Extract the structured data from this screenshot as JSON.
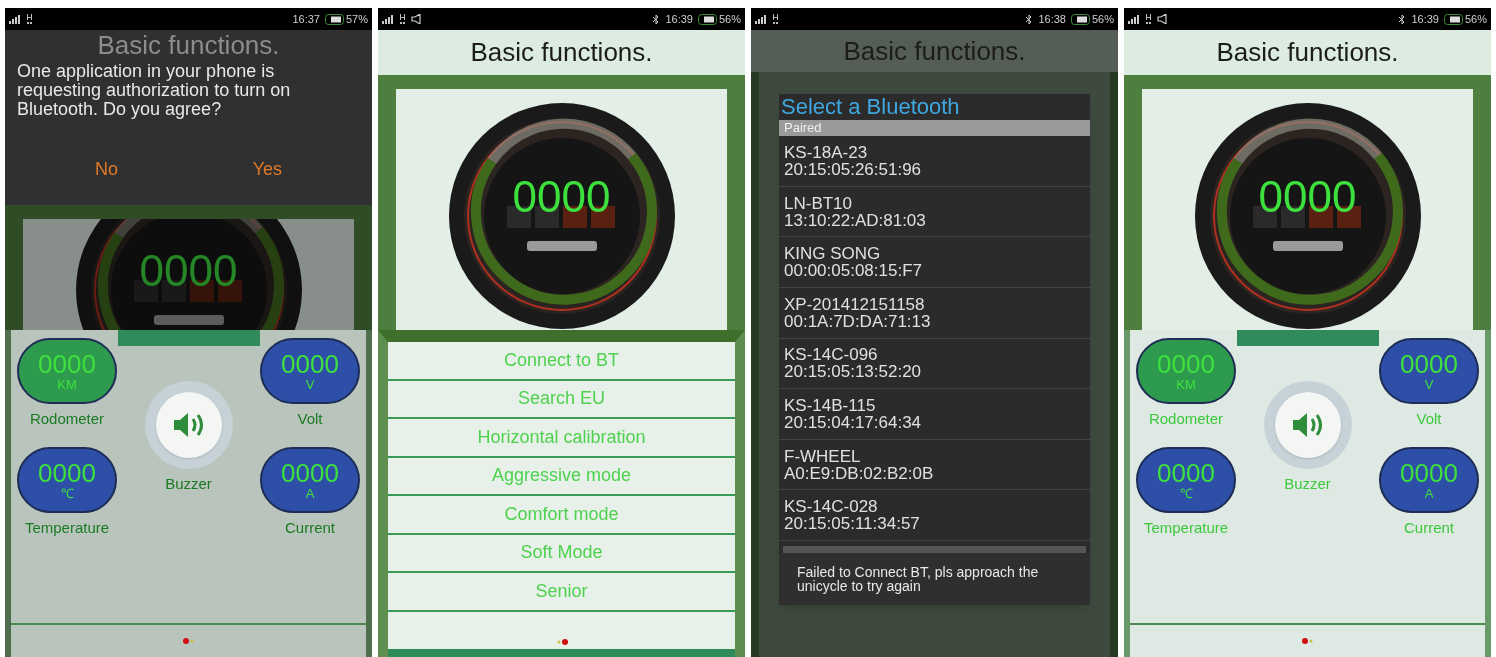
{
  "screens": [
    {
      "kind": "dashboard",
      "dimmed": true,
      "status_bar": {
        "time": "16:37",
        "battery": "57%",
        "bluetooth_icon": false,
        "volume_icon": false
      },
      "title": "Basic functions.",
      "dialog": {
        "message": "One application in your phone is requesting authorization to turn on Bluetooth. Do you agree?",
        "buttons": [
          "No",
          "Yes"
        ]
      },
      "gauge": {
        "reading": "0000"
      },
      "meters": [
        {
          "value": "0000",
          "unit": "KM",
          "label": "Rodometer",
          "color": "#2e9a4e"
        },
        {
          "value": "0000",
          "unit": "V",
          "label": "Volt",
          "color": "#2d4fa8"
        },
        {
          "value": "0000",
          "unit": "℃",
          "label": "Temperature",
          "color": "#2d4fa8"
        },
        {
          "value": "0000",
          "unit": "A",
          "label": "Current",
          "color": "#2d4fa8"
        }
      ],
      "buzzer": {
        "label": "Buzzer"
      }
    },
    {
      "kind": "menu",
      "dimmed": false,
      "status_bar": {
        "time": "16:39",
        "battery": "56%",
        "bluetooth_icon": true,
        "volume_icon": true
      },
      "title": "Basic functions.",
      "gauge": {
        "reading": "0000"
      },
      "menu_items": [
        "Connect to BT",
        "Search EU",
        "Horizontal calibration",
        "Aggressive mode",
        "Comfort mode",
        "Soft Mode",
        "Senior"
      ]
    },
    {
      "kind": "device_picker",
      "dimmed": true,
      "status_bar": {
        "time": "16:38",
        "battery": "56%",
        "bluetooth_icon": true,
        "volume_icon": false
      },
      "title": "Basic functions.",
      "picker": {
        "title": "Select a Bluetooth",
        "section": "Paired",
        "devices": [
          {
            "name": "KS-18A-23",
            "address": "20:15:05:26:51:96"
          },
          {
            "name": "LN-BT10",
            "address": "13:10:22:AD:81:03"
          },
          {
            "name": "KING SONG",
            "address": "00:00:05:08:15:F7"
          },
          {
            "name": "XP-201412151158",
            "address": "00:1A:7D:DA:71:13"
          },
          {
            "name": "KS-14C-096",
            "address": "20:15:05:13:52:20"
          },
          {
            "name": "KS-14B-115",
            "address": "20:15:04:17:64:34"
          },
          {
            "name": "F-WHEEL",
            "address": "A0:E9:DB:02:B2:0B"
          },
          {
            "name": "KS-14C-028",
            "address": "20:15:05:11:34:57"
          }
        ],
        "toast": "Failed to Connect BT, pls approach the unicycle to try again"
      }
    },
    {
      "kind": "dashboard",
      "dimmed": false,
      "status_bar": {
        "time": "16:39",
        "battery": "56%",
        "bluetooth_icon": true,
        "volume_icon": true
      },
      "title": "Basic functions.",
      "gauge": {
        "reading": "0000"
      },
      "meters": [
        {
          "value": "0000",
          "unit": "KM",
          "label": "Rodometer",
          "color": "#2e9a4e"
        },
        {
          "value": "0000",
          "unit": "V",
          "label": "Volt",
          "color": "#2d4fa8"
        },
        {
          "value": "0000",
          "unit": "℃",
          "label": "Temperature",
          "color": "#2d4fa8"
        },
        {
          "value": "0000",
          "unit": "A",
          "label": "Current",
          "color": "#2d4fa8"
        }
      ],
      "buzzer": {
        "label": "Buzzer"
      }
    }
  ]
}
